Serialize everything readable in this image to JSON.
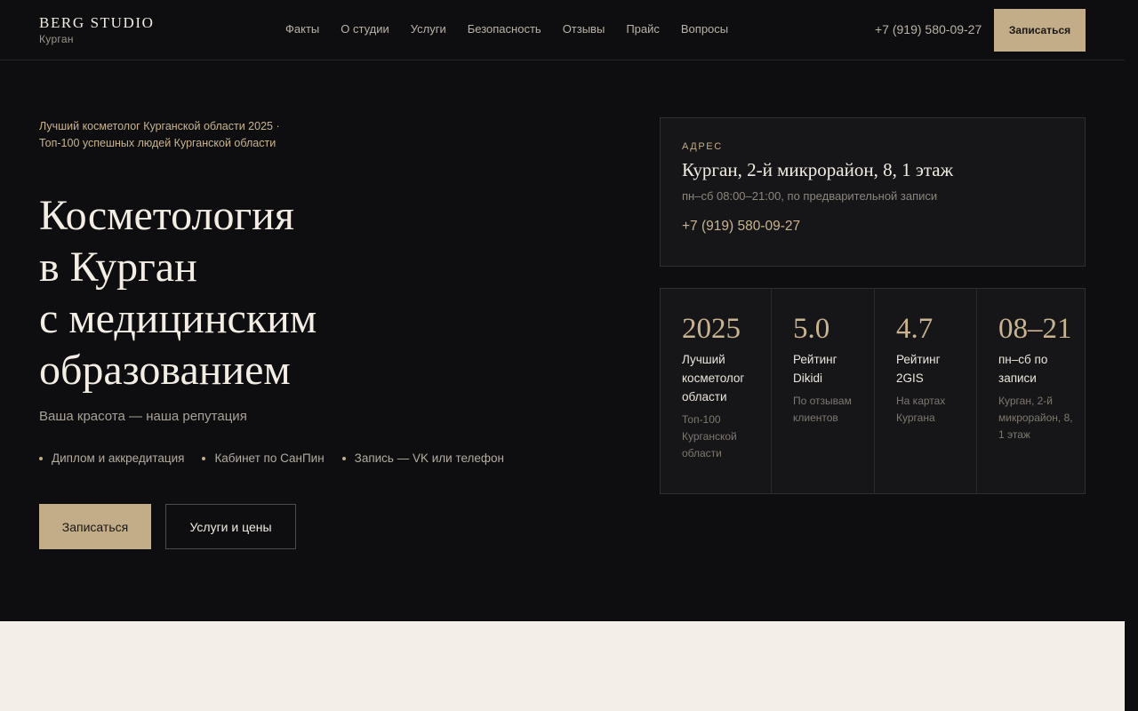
{
  "header": {
    "brand": "BERG STUDIO",
    "city": "Курган",
    "nav": [
      "Факты",
      "О студии",
      "Услуги",
      "Безопасность",
      "Отзывы",
      "Прайс",
      "Вопросы"
    ],
    "phone": "+7 (919) 580-09-27",
    "cta": "Записаться"
  },
  "hero": {
    "kicker": "Лучший косметолог Курганской области 2025 · Топ-100 успешных людей Курганской области",
    "title_lines": [
      "Косметология",
      "в Курган",
      "с медицинским",
      "образованием"
    ],
    "tagline": "Ваша красота — наша репутация",
    "features": [
      "Диплом и аккредитация",
      "Кабинет по СанПин",
      "Запись — VK или телефон"
    ],
    "primary_button": "Записаться",
    "secondary_button": "Услуги и цены"
  },
  "address": {
    "label": "АДРЕС",
    "text": "Курган, 2-й микрорайон, 8, 1 этаж",
    "hours": "пн–сб 08:00–21:00, по предварительной записи",
    "phone": "+7 (919) 580-09-27"
  },
  "stats": [
    {
      "value": "2025",
      "title": "Лучший косметолог области",
      "sub": "Топ-100 Курганской области"
    },
    {
      "value": "5.0",
      "title": "Рейтинг Dikidi",
      "sub": "По отзывам клиентов"
    },
    {
      "value": "4.7",
      "title": "Рейтинг 2GIS",
      "sub": "На картах Кургана"
    },
    {
      "value": "08–21",
      "title": "пн–сб по записи",
      "sub": "Курган, 2-й микрорайон, 8, 1 этаж"
    }
  ],
  "colors": {
    "accent": "#c3ad88",
    "background": "#0e0e10",
    "cream": "#f3eee7"
  }
}
